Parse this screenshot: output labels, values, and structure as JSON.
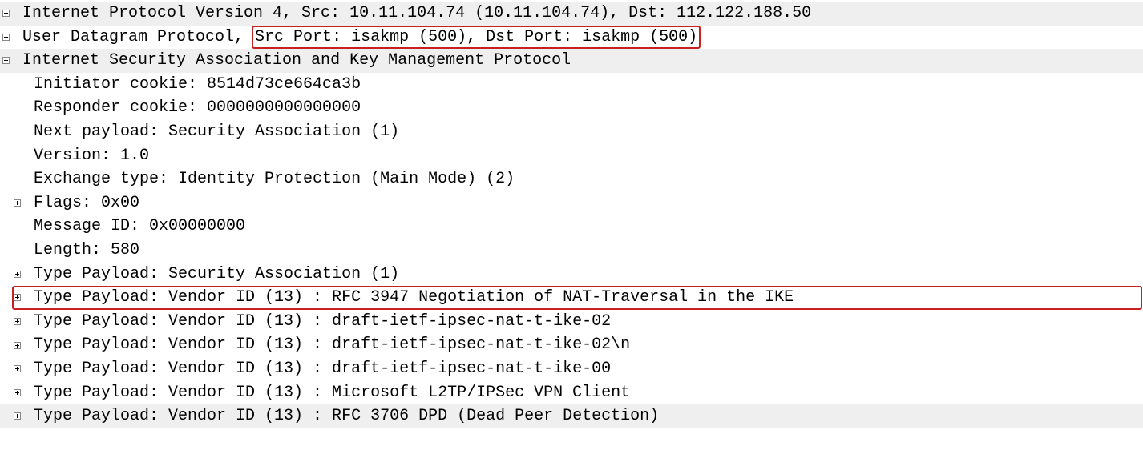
{
  "rows": [
    {
      "indent": 0,
      "branch": "plus",
      "alt": true,
      "highlight": "none",
      "prefix": "Internet Protocol Version 4, Src: 10.11.104.74 (10.11.104.74), Dst: 112.122.188.50",
      "boxed": ""
    },
    {
      "indent": 0,
      "branch": "plus",
      "alt": false,
      "highlight": "segment",
      "prefix": "User Datagram Protocol, ",
      "boxed": "Src Port: isakmp (500), Dst Port: isakmp (500)"
    },
    {
      "indent": 0,
      "branch": "minus",
      "alt": true,
      "highlight": "none",
      "prefix": "Internet Security Association and Key Management Protocol",
      "boxed": ""
    },
    {
      "indent": 1,
      "branch": "none",
      "alt": false,
      "highlight": "none",
      "prefix": "Initiator cookie: 8514d73ce664ca3b",
      "boxed": ""
    },
    {
      "indent": 1,
      "branch": "none",
      "alt": false,
      "highlight": "none",
      "prefix": "Responder cookie: 0000000000000000",
      "boxed": ""
    },
    {
      "indent": 1,
      "branch": "none",
      "alt": false,
      "highlight": "none",
      "prefix": "Next payload: Security Association (1)",
      "boxed": ""
    },
    {
      "indent": 1,
      "branch": "none",
      "alt": false,
      "highlight": "none",
      "prefix": "Version: 1.0",
      "boxed": ""
    },
    {
      "indent": 1,
      "branch": "none",
      "alt": false,
      "highlight": "none",
      "prefix": "Exchange type: Identity Protection (Main Mode) (2)",
      "boxed": ""
    },
    {
      "indent": 1,
      "branch": "plus",
      "alt": false,
      "highlight": "none",
      "prefix": "Flags: 0x00",
      "boxed": ""
    },
    {
      "indent": 1,
      "branch": "none",
      "alt": false,
      "highlight": "none",
      "prefix": "Message ID: 0x00000000",
      "boxed": ""
    },
    {
      "indent": 1,
      "branch": "none",
      "alt": false,
      "highlight": "none",
      "prefix": "Length: 580",
      "boxed": ""
    },
    {
      "indent": 1,
      "branch": "plus",
      "alt": false,
      "highlight": "none",
      "prefix": "Type Payload: Security Association (1)",
      "boxed": ""
    },
    {
      "indent": 1,
      "branch": "plus",
      "alt": false,
      "highlight": "row",
      "prefix": "Type Payload: Vendor ID (13) : RFC 3947 Negotiation of NAT-Traversal in the IKE",
      "boxed": ""
    },
    {
      "indent": 1,
      "branch": "plus",
      "alt": false,
      "highlight": "none",
      "prefix": "Type Payload: Vendor ID (13) : draft-ietf-ipsec-nat-t-ike-02",
      "boxed": ""
    },
    {
      "indent": 1,
      "branch": "plus",
      "alt": false,
      "highlight": "none",
      "prefix": "Type Payload: Vendor ID (13) : draft-ietf-ipsec-nat-t-ike-02\\n",
      "boxed": ""
    },
    {
      "indent": 1,
      "branch": "plus",
      "alt": false,
      "highlight": "none",
      "prefix": "Type Payload: Vendor ID (13) : draft-ietf-ipsec-nat-t-ike-00",
      "boxed": ""
    },
    {
      "indent": 1,
      "branch": "plus",
      "alt": false,
      "highlight": "none",
      "prefix": "Type Payload: Vendor ID (13) : Microsoft L2TP/IPSec VPN Client",
      "boxed": ""
    },
    {
      "indent": 1,
      "branch": "plus",
      "alt": true,
      "highlight": "none",
      "prefix": "Type Payload: Vendor ID (13) : RFC 3706 DPD (Dead Peer Detection)",
      "boxed": ""
    }
  ]
}
